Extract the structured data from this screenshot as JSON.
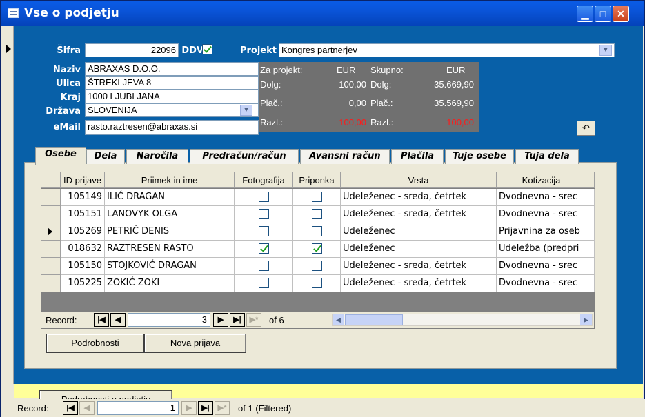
{
  "window": {
    "title": "Vse o podjetju",
    "min_icon": "minimize-icon",
    "max_icon": "maximize-icon",
    "close_icon": "close-icon"
  },
  "company": {
    "sifra_label": "Šifra",
    "sifra_value": "22096",
    "ddv_label": "DDV",
    "ddv_checked": true,
    "projekt_label": "Projekt",
    "projekt_value": "Kongres partnerjev",
    "naziv_label": "Naziv",
    "naziv_value": "ABRAXAS D.O.O.",
    "ulica_label": "Ulica",
    "ulica_value": "ŠTREKLJEVA 8",
    "kraj_label": "Kraj",
    "kraj_value": "1000 LJUBLJANA",
    "drzava_label": "Država",
    "drzava_value": "SLOVENIJA",
    "email_label": "eMail",
    "email_value": "rasto.raztresen@abraxas.si"
  },
  "summary": {
    "za_projekt_label": "Za projekt:",
    "za_projekt_cur": "EUR",
    "skupno_label": "Skupno:",
    "skupno_cur": "EUR",
    "dolg_label": "Dolg:",
    "dolg_projekt": "100,00",
    "dolg_skupno": "35.669,90",
    "plac_label": "Plač.:",
    "plac_projekt": "0,00",
    "plac_skupno": "35.569,90",
    "razl_label": "Razl.:",
    "razl_projekt": "-100,00",
    "razl_skupno": "-100,00"
  },
  "tabs": [
    "Osebe",
    "Dela",
    "Naročila",
    "Predračun/račun",
    "Avansni račun",
    "Plačila",
    "Tuje osebe",
    "Tuja dela"
  ],
  "grid": {
    "headers": [
      "ID prijave",
      "Priimek in ime",
      "Fotografija",
      "Priponka",
      "Vrsta",
      "Kotizacija"
    ],
    "rows": [
      {
        "id": "105149",
        "name": "ILIĆ DRAGAN",
        "foto": false,
        "prip": false,
        "vrsta": "Udeleženec - sreda, četrtek",
        "kot": "Dvodnevna - srec"
      },
      {
        "id": "105151",
        "name": "LANOVYK OLGA",
        "foto": false,
        "prip": false,
        "vrsta": "Udeleženec - sreda, četrtek",
        "kot": "Dvodnevna - srec"
      },
      {
        "id": "105269",
        "name": "PETRIĆ DENIS",
        "foto": false,
        "prip": false,
        "vrsta": "Udeleženec",
        "kot": "Prijavnina za oseb"
      },
      {
        "id": "018632",
        "name": "RAZTRESEN RASTO",
        "foto": true,
        "prip": true,
        "vrsta": "Udeleženec",
        "kot": "Udeležba (predpri"
      },
      {
        "id": "105150",
        "name": "STOJKOVIĆ DRAGAN",
        "foto": false,
        "prip": false,
        "vrsta": "Udeleženec - sreda, četrtek",
        "kot": "Dvodnevna - srec"
      },
      {
        "id": "105225",
        "name": "ZOKIĆ ZOKI",
        "foto": false,
        "prip": false,
        "vrsta": "Udeleženec - sreda, četrtek",
        "kot": "Dvodnevna - srec"
      }
    ],
    "current_row": 2
  },
  "subnav": {
    "record_label": "Record:",
    "current": "3",
    "of_text": "of 6"
  },
  "buttons": {
    "podrobnosti": "Podrobnosti",
    "nova_prijava": "Nova prijava",
    "podrobnosti_podjetju": "Podrobnosti o podjetju"
  },
  "mainnav": {
    "record_label": "Record:",
    "current": "1",
    "of_text": "of 1 (Filtered)"
  },
  "colors": {
    "form_bg": "#0860a8",
    "footer_bg": "#ffff99",
    "negative": "#ff1a1a"
  }
}
